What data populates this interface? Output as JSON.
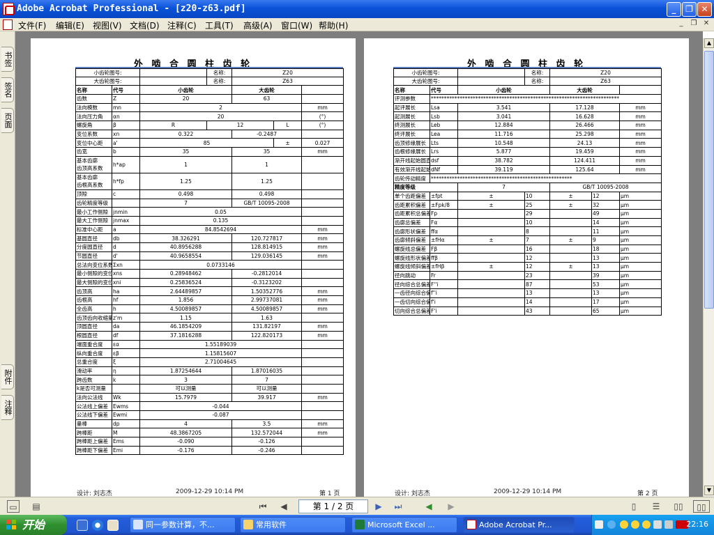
{
  "window": {
    "title": "Adobe Acrobat Professional - [z20-z63.pdf]"
  },
  "menu": {
    "items": [
      "文件(F)",
      "编辑(E)",
      "视图(V)",
      "文档(D)",
      "注释(C)",
      "工具(T)",
      "高级(A)",
      "窗口(W)",
      "帮助(H)"
    ]
  },
  "sidebar": {
    "tabs": [
      "书签",
      "签名",
      "页面",
      "附件",
      "注释"
    ]
  },
  "page1": {
    "title": "外 啮 合 圆 柱 齿 轮",
    "header": [
      [
        "小齿轮图号:",
        "",
        "名称:",
        "Z20"
      ],
      [
        "大齿轮图号:",
        "",
        "名称:",
        "Z63"
      ]
    ],
    "colhead": [
      "名称",
      "代号",
      "小齿轮",
      "大齿轮"
    ],
    "rows": [
      [
        "齿数",
        "Z",
        "20",
        "63",
        ""
      ],
      [
        "法向模数",
        "mn",
        "2",
        "",
        "mm"
      ],
      [
        "法向压力角",
        "αn",
        "20",
        "",
        "(°)"
      ],
      [
        "螺旋角",
        "β",
        "R",
        "12",
        "L",
        "(°)"
      ],
      [
        "变位系数",
        "xn",
        "0.322",
        "-0.2487",
        ""
      ],
      [
        "变位中心距",
        "a'",
        "85",
        "±",
        "0.027"
      ],
      [
        "齿宽",
        "b",
        "35",
        "35",
        "mm"
      ],
      [
        "基本齿廓\n齿顶高系数",
        "h*ap",
        "1",
        "1",
        ""
      ],
      [
        "基本齿廓\n齿根高系数",
        "h*fp",
        "1.25",
        "1.25",
        ""
      ],
      [
        "顶隙",
        "c",
        "0.498",
        "0.498",
        ""
      ],
      [
        "齿轮精度等级",
        "",
        "7",
        "GB/T 10095-2008",
        ""
      ],
      [
        "最小工作侧隙",
        "jnmin",
        "0.05",
        "",
        ""
      ],
      [
        "最大工作侧隙",
        "jnmax",
        "0.135",
        "",
        ""
      ],
      [
        "标准中心距",
        "a",
        "84.8542694",
        "",
        "mm"
      ],
      [
        "基圆直径",
        "db",
        "38.326291",
        "120.727817",
        "mm"
      ],
      [
        "分度圆直径",
        "d",
        "40.8956288",
        "128.814915",
        "mm"
      ],
      [
        "节圆直径",
        "d'",
        "40.9658554",
        "129.036145",
        "mm"
      ],
      [
        "总法向变位系数",
        "Σxn",
        "0.0733146",
        "",
        ""
      ],
      [
        "最小侧隙的变位系数",
        "xns",
        "0.28948462",
        "-0.2812014",
        ""
      ],
      [
        "最大侧隙的变位系数",
        "xni",
        "0.25836524",
        "-0.3123202",
        ""
      ],
      [
        "齿顶高",
        "ha",
        "2.64489857",
        "1.50352776",
        "mm"
      ],
      [
        "齿根高",
        "hf",
        "1.856",
        "2.99737081",
        "mm"
      ],
      [
        "全齿高",
        "h",
        "4.50089857",
        "4.50089857",
        "mm"
      ],
      [
        "齿顶齿向收缩量",
        "z'm",
        "1.15",
        "1.63",
        ""
      ],
      [
        "顶圆直径",
        "da",
        "46.1854209",
        "131.82197",
        "mm"
      ],
      [
        "根圆直径",
        "df",
        "37.1816288",
        "122.820173",
        "mm"
      ],
      [
        "端面重合度",
        "εα",
        "1.55189039",
        "",
        ""
      ],
      [
        "纵向重合度",
        "εβ",
        "1.15815607",
        "",
        ""
      ],
      [
        "总重合度",
        "ξ",
        "2.71004645",
        "",
        ""
      ],
      [
        "滑动率",
        "η",
        "1.87254644",
        "1.87016035",
        ""
      ],
      [
        "跨齿数",
        "k",
        "3",
        "7",
        ""
      ],
      [
        "k是否可测量",
        "",
        "可以测量",
        "可以测量",
        ""
      ],
      [
        "法向公法线",
        "Wk",
        "15.7979",
        "39.917",
        "mm"
      ],
      [
        "公法线上偏差",
        "Ewms",
        "-0.044",
        "",
        ""
      ],
      [
        "公法线下偏差",
        "Ewmi",
        "-0.087",
        "",
        ""
      ],
      [
        "量棒",
        "dp",
        "4",
        "3.5",
        "mm"
      ],
      [
        "跨棒距",
        "M",
        "48.3867205",
        "132.572044",
        "mm"
      ],
      [
        "跨棒距上偏差",
        "Ems",
        "-0.090",
        "-0.126",
        ""
      ],
      [
        "跨棒距下偏差",
        "Emi",
        "-0.176",
        "-0.246",
        ""
      ]
    ],
    "footer": {
      "designer": "设计: 刘志杰",
      "datetime": "2009-12-29 10:14 PM",
      "page": "第 1 页"
    }
  },
  "page2": {
    "title": "外 啮 合 圆 柱 齿 轮",
    "header": [
      [
        "小齿轮图号:",
        "",
        "名称:",
        "Z20"
      ],
      [
        "大齿轮图号:",
        "",
        "名称:",
        "Z63"
      ]
    ],
    "colhead": [
      "名称",
      "代号",
      "小齿轮",
      "大齿轮"
    ],
    "eval_label": "评测参数",
    "eval_stars": "************************************************************************",
    "rows": [
      [
        "起评展长",
        "Lsa",
        "3.541",
        "17.128",
        "mm"
      ],
      [
        "起测展长",
        "Lsb",
        "3.041",
        "16.628",
        "mm"
      ],
      [
        "终测展长",
        "Leb",
        "12.884",
        "26.466",
        "mm"
      ],
      [
        "终评展长",
        "Lea",
        "11.716",
        "25.298",
        "mm"
      ],
      [
        "齿顶修缘展长",
        "Lts",
        "10.548",
        "24.13",
        "mm"
      ],
      [
        "齿根修缘展长",
        "Lrs",
        "5.877",
        "19.459",
        "mm"
      ],
      [
        "渐开线起始圆直径",
        "dsf",
        "38.782",
        "124.411",
        "mm"
      ],
      [
        "有效渐开线起始圆直径",
        "dNf",
        "39.119",
        "125.64",
        "mm"
      ]
    ],
    "acc_label": "齿轮传动精度",
    "acc_stars": "******************************************************",
    "grade_label": "精度等级",
    "grade_value": "7",
    "grade_std": "GB/T 10095-2008",
    "devs": [
      [
        "单个齿距偏差",
        "±fpt",
        "±",
        "10",
        "±",
        "12",
        "μm"
      ],
      [
        "齿距累积偏差",
        "±Fpk/8",
        "±",
        "25",
        "±",
        "32",
        "μm"
      ],
      [
        "齿距累积总偏差",
        "Fp",
        "",
        "29",
        "",
        "49",
        "μm"
      ],
      [
        "齿廓总偏差",
        "Fα",
        "",
        "10",
        "",
        "14",
        "μm"
      ],
      [
        "齿廓形状偏差",
        "ffα",
        "",
        "8",
        "",
        "11",
        "μm"
      ],
      [
        "齿廓倾斜偏差",
        "±fHα",
        "±",
        "7",
        "±",
        "9",
        "μm"
      ],
      [
        "螺旋线总偏差",
        "Fβ",
        "",
        "16",
        "",
        "18",
        "μm"
      ],
      [
        "螺旋线形状偏差",
        "ffβ",
        "",
        "12",
        "",
        "13",
        "μm"
      ],
      [
        "螺旋线倾斜偏差",
        "±fHβ",
        "±",
        "12",
        "±",
        "13",
        "μm"
      ],
      [
        "径向跳动",
        "Fr",
        "",
        "23",
        "",
        "39",
        "μm"
      ],
      [
        "径向综合总偏差",
        "F''i",
        "",
        "87",
        "",
        "53",
        "μm"
      ],
      [
        "一齿径向综合偏差",
        "f''i",
        "",
        "13",
        "",
        "13",
        "μm"
      ],
      [
        "一齿切向综合偏差",
        "f'i",
        "",
        "14",
        "",
        "17",
        "μm"
      ],
      [
        "切向综合总偏差",
        "F'i",
        "",
        "43",
        "",
        "65",
        "μm"
      ]
    ],
    "footer": {
      "designer": "设计: 刘志杰",
      "datetime": "2009-12-29 10:14 PM",
      "page": "第 2 页"
    }
  },
  "navigation": {
    "page_display": "第 1 / 2 页"
  },
  "taskbar": {
    "start_label": "开始",
    "tasks": [
      "同一参数计算，不...",
      "常用软件",
      "Microsoft Excel ...",
      "Adobe Acrobat Pr..."
    ],
    "clock": "22:16"
  },
  "colors": {
    "titlebar": "#0a52d8",
    "taskbar": "#245edb",
    "start": "#2f8f2f",
    "docbg": "#7e7e7e",
    "tray": "#1385db"
  }
}
